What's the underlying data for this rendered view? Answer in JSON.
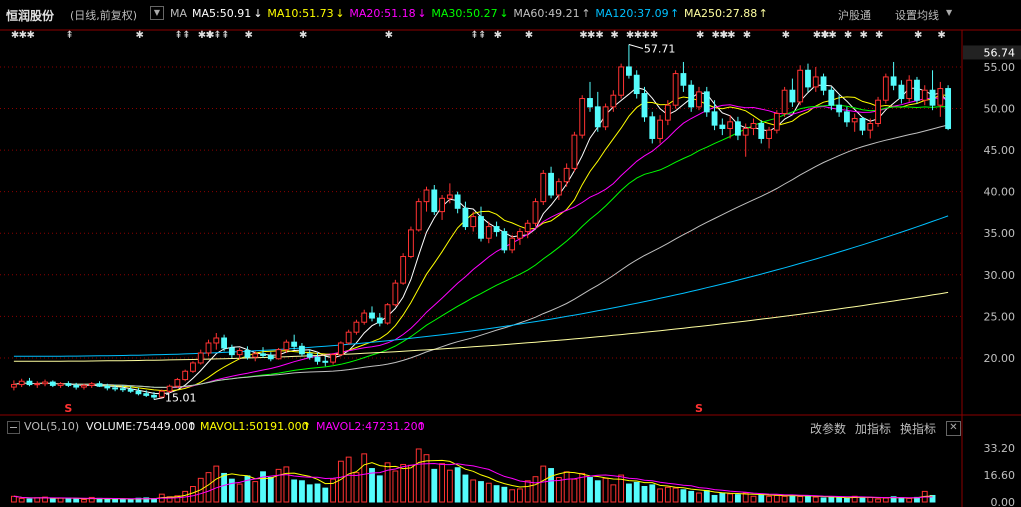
{
  "header": {
    "stock_name": "恒润股份",
    "period": "(日线,前复权)",
    "dropdown_icon": "chevron-down-icon",
    "ma_label": "MA",
    "ma_items": [
      {
        "label": "MA5:50.91",
        "arrow": "↓",
        "color": "#ffffff"
      },
      {
        "label": "MA10:51.73",
        "arrow": "↓",
        "color": "#ffff00"
      },
      {
        "label": "MA20:51.18",
        "arrow": "↓",
        "color": "#ff00ff"
      },
      {
        "label": "MA30:50.27",
        "arrow": "↓",
        "color": "#00ff00"
      },
      {
        "label": "MA60:49.21",
        "arrow": "↑",
        "color": "#c0c0c0"
      },
      {
        "label": "MA120:37.09",
        "arrow": "↑",
        "color": "#00c0ff"
      },
      {
        "label": "MA250:27.88",
        "arrow": "↑",
        "color": "#ffffa0"
      }
    ],
    "hgt_button": "沪股通",
    "settings_button": "设置均线"
  },
  "volume_header": {
    "indicator": "VOL(5,10)",
    "volume": "VOLUME:75449.000",
    "volume_arrow": "↑",
    "mavol1": "MAVOL1:50191.000",
    "mavol1_arrow": "↑",
    "mavol2": "MAVOL2:47231.200",
    "mavol2_arrow": "↑",
    "change_params": "改参数",
    "add_indicator": "加指标",
    "switch_indicator": "换指标",
    "close": "✕"
  },
  "chart_data": {
    "type": "candlestick",
    "colors": {
      "up": "#ff3232",
      "down": "#54fcfc",
      "grid": "#8b0000",
      "axis_text": "#c0c0c0"
    },
    "price_axis": {
      "ticks": [
        20.0,
        25.0,
        30.0,
        35.0,
        40.0,
        45.0,
        50.0,
        55.0
      ],
      "ylim": [
        13.5,
        58.0
      ],
      "last_price": "56.74"
    },
    "volume_axis": {
      "ticks": [
        "0.00",
        "16.60",
        "33.20"
      ],
      "ylim": [
        0,
        38
      ]
    },
    "annotations": [
      {
        "text": "57.71",
        "kind": "high"
      },
      {
        "text": "15.01",
        "kind": "low"
      }
    ],
    "signals": [
      "S",
      "S"
    ],
    "marker_symbols": [
      "✱",
      "⇞"
    ],
    "ma_series": [
      "MA5",
      "MA10",
      "MA20",
      "MA30",
      "MA60",
      "MA120",
      "MA250"
    ],
    "ohlc": [
      {
        "o": 16.5,
        "h": 17.3,
        "l": 16.1,
        "c": 16.8
      },
      {
        "o": 16.8,
        "h": 17.5,
        "l": 16.5,
        "c": 17.2
      },
      {
        "o": 17.2,
        "h": 17.6,
        "l": 16.6,
        "c": 16.8
      },
      {
        "o": 16.8,
        "h": 17.2,
        "l": 16.4,
        "c": 16.9
      },
      {
        "o": 16.9,
        "h": 17.4,
        "l": 16.6,
        "c": 17.1
      },
      {
        "o": 17.1,
        "h": 17.3,
        "l": 16.5,
        "c": 16.7
      },
      {
        "o": 16.7,
        "h": 17.1,
        "l": 16.4,
        "c": 16.9
      },
      {
        "o": 16.9,
        "h": 17.2,
        "l": 16.5,
        "c": 16.7
      },
      {
        "o": 16.7,
        "h": 17.0,
        "l": 16.2,
        "c": 16.5
      },
      {
        "o": 16.5,
        "h": 16.9,
        "l": 16.2,
        "c": 16.7
      },
      {
        "o": 16.7,
        "h": 17.1,
        "l": 16.4,
        "c": 16.9
      },
      {
        "o": 16.9,
        "h": 17.2,
        "l": 16.5,
        "c": 16.6
      },
      {
        "o": 16.6,
        "h": 16.9,
        "l": 16.1,
        "c": 16.4
      },
      {
        "o": 16.4,
        "h": 16.8,
        "l": 16.0,
        "c": 16.3
      },
      {
        "o": 16.3,
        "h": 16.7,
        "l": 15.9,
        "c": 16.2
      },
      {
        "o": 16.2,
        "h": 16.6,
        "l": 15.8,
        "c": 16.0
      },
      {
        "o": 16.0,
        "h": 16.4,
        "l": 15.5,
        "c": 15.7
      },
      {
        "o": 15.7,
        "h": 16.1,
        "l": 15.3,
        "c": 15.5
      },
      {
        "o": 15.5,
        "h": 15.9,
        "l": 15.0,
        "c": 15.3
      },
      {
        "o": 15.3,
        "h": 16.2,
        "l": 15.1,
        "c": 16.0
      },
      {
        "o": 16.0,
        "h": 16.8,
        "l": 15.8,
        "c": 16.6
      },
      {
        "o": 16.6,
        "h": 17.6,
        "l": 16.4,
        "c": 17.4
      },
      {
        "o": 17.4,
        "h": 18.6,
        "l": 17.2,
        "c": 18.4
      },
      {
        "o": 18.4,
        "h": 19.6,
        "l": 18.2,
        "c": 19.4
      },
      {
        "o": 19.4,
        "h": 21.0,
        "l": 19.2,
        "c": 20.6
      },
      {
        "o": 20.6,
        "h": 22.2,
        "l": 20.2,
        "c": 21.8
      },
      {
        "o": 21.8,
        "h": 23.0,
        "l": 21.0,
        "c": 22.4
      },
      {
        "o": 22.4,
        "h": 22.8,
        "l": 20.8,
        "c": 21.2
      },
      {
        "o": 21.2,
        "h": 21.6,
        "l": 20.0,
        "c": 20.4
      },
      {
        "o": 20.4,
        "h": 21.2,
        "l": 19.8,
        "c": 20.9
      },
      {
        "o": 20.9,
        "h": 21.4,
        "l": 19.8,
        "c": 20.1
      },
      {
        "o": 20.1,
        "h": 20.8,
        "l": 19.6,
        "c": 20.5
      },
      {
        "o": 20.5,
        "h": 21.3,
        "l": 20.0,
        "c": 20.3
      },
      {
        "o": 20.3,
        "h": 20.7,
        "l": 19.6,
        "c": 19.9
      },
      {
        "o": 19.9,
        "h": 21.2,
        "l": 19.8,
        "c": 21.0
      },
      {
        "o": 21.0,
        "h": 22.2,
        "l": 20.6,
        "c": 21.9
      },
      {
        "o": 21.9,
        "h": 22.8,
        "l": 21.0,
        "c": 21.4
      },
      {
        "o": 21.4,
        "h": 21.8,
        "l": 20.2,
        "c": 20.5
      },
      {
        "o": 20.5,
        "h": 21.0,
        "l": 19.8,
        "c": 20.1
      },
      {
        "o": 20.1,
        "h": 20.6,
        "l": 19.2,
        "c": 19.6
      },
      {
        "o": 19.6,
        "h": 20.2,
        "l": 19.0,
        "c": 19.5
      },
      {
        "o": 19.5,
        "h": 20.6,
        "l": 19.2,
        "c": 20.4
      },
      {
        "o": 20.4,
        "h": 22.0,
        "l": 20.2,
        "c": 21.8
      },
      {
        "o": 21.8,
        "h": 23.4,
        "l": 21.6,
        "c": 23.1
      },
      {
        "o": 23.1,
        "h": 24.6,
        "l": 22.8,
        "c": 24.3
      },
      {
        "o": 24.3,
        "h": 25.8,
        "l": 24.0,
        "c": 25.4
      },
      {
        "o": 25.4,
        "h": 26.2,
        "l": 24.4,
        "c": 24.8
      },
      {
        "o": 24.8,
        "h": 25.4,
        "l": 23.8,
        "c": 24.2
      },
      {
        "o": 24.2,
        "h": 26.6,
        "l": 24.0,
        "c": 26.4
      },
      {
        "o": 26.4,
        "h": 29.4,
        "l": 26.2,
        "c": 29.0
      },
      {
        "o": 29.0,
        "h": 32.6,
        "l": 28.8,
        "c": 32.2
      },
      {
        "o": 32.2,
        "h": 35.8,
        "l": 32.0,
        "c": 35.4
      },
      {
        "o": 35.4,
        "h": 39.2,
        "l": 35.2,
        "c": 38.8
      },
      {
        "o": 38.8,
        "h": 40.6,
        "l": 37.6,
        "c": 40.2
      },
      {
        "o": 40.2,
        "h": 40.8,
        "l": 37.2,
        "c": 37.6
      },
      {
        "o": 37.6,
        "h": 39.6,
        "l": 36.6,
        "c": 39.2
      },
      {
        "o": 39.2,
        "h": 41.0,
        "l": 38.6,
        "c": 39.6
      },
      {
        "o": 39.6,
        "h": 40.0,
        "l": 37.4,
        "c": 38.0
      },
      {
        "o": 38.0,
        "h": 38.8,
        "l": 35.4,
        "c": 35.8
      },
      {
        "o": 35.8,
        "h": 37.6,
        "l": 35.2,
        "c": 37.0
      },
      {
        "o": 37.0,
        "h": 38.2,
        "l": 34.0,
        "c": 34.4
      },
      {
        "o": 34.4,
        "h": 36.4,
        "l": 33.8,
        "c": 35.8
      },
      {
        "o": 35.8,
        "h": 36.4,
        "l": 34.6,
        "c": 35.2
      },
      {
        "o": 35.2,
        "h": 35.6,
        "l": 32.6,
        "c": 33.0
      },
      {
        "o": 33.0,
        "h": 34.8,
        "l": 32.6,
        "c": 34.4
      },
      {
        "o": 34.4,
        "h": 35.6,
        "l": 33.6,
        "c": 35.2
      },
      {
        "o": 35.2,
        "h": 36.6,
        "l": 34.4,
        "c": 36.2
      },
      {
        "o": 36.2,
        "h": 39.2,
        "l": 35.8,
        "c": 38.8
      },
      {
        "o": 38.8,
        "h": 42.6,
        "l": 38.4,
        "c": 42.2
      },
      {
        "o": 42.2,
        "h": 43.0,
        "l": 39.2,
        "c": 39.6
      },
      {
        "o": 39.6,
        "h": 41.6,
        "l": 39.0,
        "c": 41.2
      },
      {
        "o": 41.2,
        "h": 43.4,
        "l": 40.6,
        "c": 42.8
      },
      {
        "o": 42.8,
        "h": 47.2,
        "l": 42.4,
        "c": 46.8
      },
      {
        "o": 46.8,
        "h": 51.6,
        "l": 46.4,
        "c": 51.2
      },
      {
        "o": 51.2,
        "h": 53.2,
        "l": 49.6,
        "c": 50.2
      },
      {
        "o": 50.2,
        "h": 52.0,
        "l": 47.2,
        "c": 47.8
      },
      {
        "o": 47.8,
        "h": 50.6,
        "l": 47.4,
        "c": 50.2
      },
      {
        "o": 50.2,
        "h": 52.2,
        "l": 49.6,
        "c": 51.6
      },
      {
        "o": 51.6,
        "h": 55.4,
        "l": 51.2,
        "c": 55.0
      },
      {
        "o": 55.0,
        "h": 57.7,
        "l": 53.6,
        "c": 54.0
      },
      {
        "o": 54.0,
        "h": 54.6,
        "l": 51.2,
        "c": 51.8
      },
      {
        "o": 51.8,
        "h": 52.6,
        "l": 48.4,
        "c": 49.0
      },
      {
        "o": 49.0,
        "h": 49.6,
        "l": 45.8,
        "c": 46.4
      },
      {
        "o": 46.4,
        "h": 49.2,
        "l": 45.8,
        "c": 48.6
      },
      {
        "o": 48.6,
        "h": 51.0,
        "l": 48.0,
        "c": 50.4
      },
      {
        "o": 50.4,
        "h": 54.6,
        "l": 50.0,
        "c": 54.2
      },
      {
        "o": 54.2,
        "h": 55.6,
        "l": 52.0,
        "c": 52.8
      },
      {
        "o": 52.8,
        "h": 53.4,
        "l": 49.6,
        "c": 50.2
      },
      {
        "o": 50.2,
        "h": 52.6,
        "l": 49.8,
        "c": 52.0
      },
      {
        "o": 52.0,
        "h": 52.6,
        "l": 49.0,
        "c": 49.6
      },
      {
        "o": 49.6,
        "h": 51.0,
        "l": 47.4,
        "c": 48.0
      },
      {
        "o": 48.0,
        "h": 48.8,
        "l": 46.8,
        "c": 47.6
      },
      {
        "o": 47.6,
        "h": 49.2,
        "l": 46.4,
        "c": 48.4
      },
      {
        "o": 48.4,
        "h": 49.0,
        "l": 46.2,
        "c": 46.8
      },
      {
        "o": 46.8,
        "h": 48.2,
        "l": 44.2,
        "c": 47.6
      },
      {
        "o": 47.6,
        "h": 48.8,
        "l": 46.8,
        "c": 48.2
      },
      {
        "o": 48.2,
        "h": 48.6,
        "l": 45.8,
        "c": 46.4
      },
      {
        "o": 46.4,
        "h": 47.8,
        "l": 45.2,
        "c": 47.4
      },
      {
        "o": 47.4,
        "h": 49.8,
        "l": 47.0,
        "c": 49.4
      },
      {
        "o": 49.4,
        "h": 52.6,
        "l": 49.0,
        "c": 52.2
      },
      {
        "o": 52.2,
        "h": 53.6,
        "l": 50.2,
        "c": 50.8
      },
      {
        "o": 50.8,
        "h": 55.2,
        "l": 50.4,
        "c": 54.6
      },
      {
        "o": 54.6,
        "h": 55.4,
        "l": 52.0,
        "c": 52.6
      },
      {
        "o": 52.6,
        "h": 55.0,
        "l": 52.0,
        "c": 53.8
      },
      {
        "o": 53.8,
        "h": 54.2,
        "l": 51.6,
        "c": 52.2
      },
      {
        "o": 52.2,
        "h": 52.6,
        "l": 49.8,
        "c": 50.4
      },
      {
        "o": 50.4,
        "h": 51.6,
        "l": 49.0,
        "c": 49.6
      },
      {
        "o": 49.6,
        "h": 50.2,
        "l": 47.8,
        "c": 48.4
      },
      {
        "o": 48.4,
        "h": 49.4,
        "l": 47.2,
        "c": 48.8
      },
      {
        "o": 48.8,
        "h": 49.0,
        "l": 46.8,
        "c": 47.4
      },
      {
        "o": 47.4,
        "h": 48.8,
        "l": 46.4,
        "c": 48.2
      },
      {
        "o": 48.2,
        "h": 51.4,
        "l": 47.8,
        "c": 51.0
      },
      {
        "o": 51.0,
        "h": 54.2,
        "l": 50.6,
        "c": 53.8
      },
      {
        "o": 53.8,
        "h": 55.6,
        "l": 52.2,
        "c": 52.8
      },
      {
        "o": 52.8,
        "h": 53.4,
        "l": 50.6,
        "c": 51.2
      },
      {
        "o": 51.2,
        "h": 54.0,
        "l": 50.8,
        "c": 53.4
      },
      {
        "o": 53.4,
        "h": 53.8,
        "l": 50.6,
        "c": 51.0
      },
      {
        "o": 51.0,
        "h": 52.8,
        "l": 50.4,
        "c": 52.2
      },
      {
        "o": 52.2,
        "h": 54.6,
        "l": 49.8,
        "c": 50.4
      },
      {
        "o": 50.4,
        "h": 53.2,
        "l": 49.0,
        "c": 52.4
      },
      {
        "o": 52.4,
        "h": 52.8,
        "l": 47.4,
        "c": 47.6
      }
    ],
    "volume_values": [
      3.5,
      2.2,
      1.8,
      2.6,
      3.0,
      2.1,
      2.4,
      1.9,
      2.0,
      1.5,
      2.8,
      2.2,
      1.7,
      2.0,
      1.6,
      1.8,
      2.3,
      2.5,
      2.0,
      4.8,
      3.2,
      3.8,
      6.5,
      9.5,
      14.5,
      18.0,
      22.0,
      17.5,
      14.0,
      11.0,
      16.0,
      12.5,
      18.5,
      15.0,
      20.0,
      21.5,
      13.5,
      13.0,
      10.5,
      11.0,
      8.5,
      14.0,
      25.0,
      27.5,
      18.0,
      29.5,
      20.5,
      16.0,
      24.0,
      19.0,
      23.0,
      22.5,
      32.5,
      29.0,
      20.0,
      23.5,
      19.5,
      21.0,
      16.5,
      13.5,
      12.5,
      11.5,
      10.0,
      9.0,
      7.5,
      8.0,
      13.0,
      15.5,
      22.0,
      20.5,
      15.0,
      18.5,
      14.0,
      17.5,
      15.0,
      13.0,
      14.5,
      10.5,
      16.5,
      11.0,
      12.0,
      9.5,
      10.5,
      8.0,
      9.0,
      8.5,
      7.5,
      6.5,
      5.5,
      7.0,
      4.0,
      5.5,
      5.0,
      4.5,
      5.5,
      3.5,
      4.5,
      3.5,
      4.0,
      3.5,
      4.2,
      3.4,
      3.8,
      3.0,
      2.5,
      3.0,
      2.6,
      2.2,
      3.5,
      3.0,
      2.8,
      1.8,
      2.4,
      3.2,
      2.6,
      2.2,
      2.8,
      6.5,
      4.0
    ],
    "marker_rows": {
      "ma_symbols": [
        0,
        1,
        2,
        7,
        16,
        21,
        22,
        24,
        25,
        26,
        27,
        30,
        37,
        48,
        59,
        60,
        62,
        66,
        73,
        74,
        77,
        79,
        80,
        81,
        88,
        90,
        91,
        92,
        94,
        99,
        103,
        104,
        105,
        107,
        109,
        111,
        116,
        119
      ],
      "marker_types": [
        "✱",
        "✱",
        "✱",
        "⇞",
        "✱",
        "⇞",
        "⇞",
        "✱✱",
        "✱",
        "⇞",
        "⇞",
        "✱",
        "✱",
        "✱",
        "⇞",
        "⇞",
        "✱",
        "✱",
        "✱",
        "✱✱",
        "✱",
        "✱",
        "✱",
        "✱✱",
        "✱",
        "✱✱",
        "✱",
        "✱",
        "✱",
        "✱",
        "✱✱",
        "✱",
        "✱",
        "✱",
        "✱",
        "✱",
        "✱",
        "✱"
      ]
    }
  }
}
